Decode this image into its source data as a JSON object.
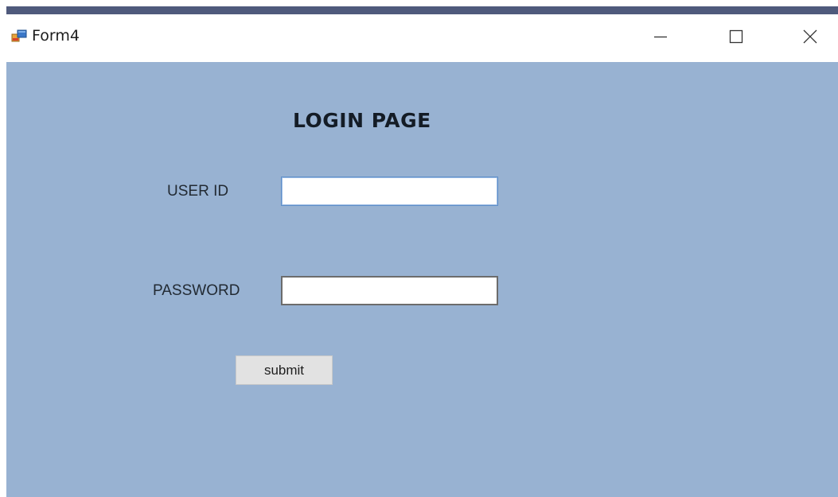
{
  "window": {
    "title": "Form4",
    "title_bar_color": "#ffffff",
    "top_strip_color": "#4f5a7c",
    "controls": {
      "minimize_icon": "minimize-icon",
      "maximize_icon": "maximize-icon",
      "close_icon": "close-icon"
    },
    "app_icon": "form-app-icon"
  },
  "form": {
    "background_color": "#98b2d2",
    "heading": "LOGIN PAGE",
    "user_id": {
      "label": "USER ID",
      "value": ""
    },
    "password": {
      "label": "PASSWORD",
      "value": ""
    },
    "submit_label": "submit"
  }
}
